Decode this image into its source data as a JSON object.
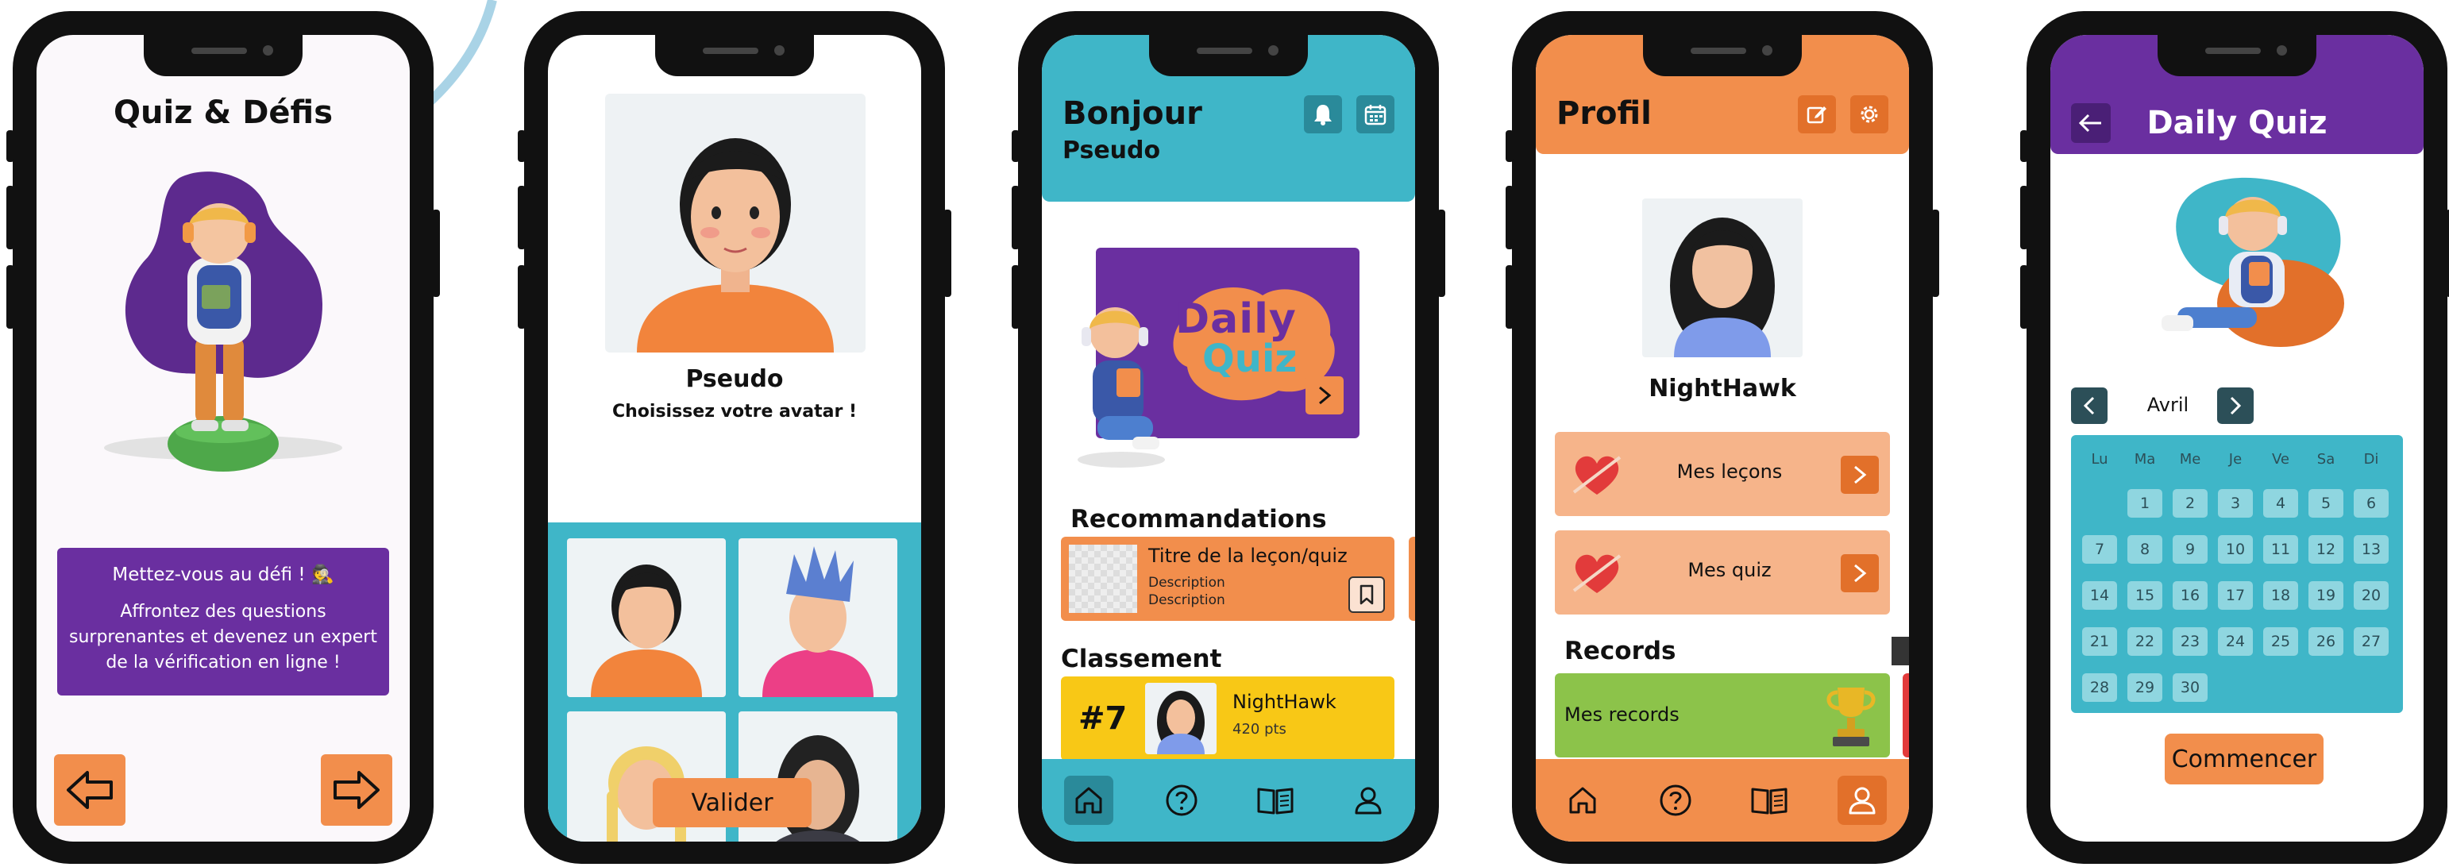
{
  "screen1": {
    "title": "Quiz & Défis",
    "card_line1": "Mettez-vous au défi ! 🕵",
    "card_line2": "Affrontez des questions surprenantes et devenez un expert de la vérification en ligne !"
  },
  "screen2": {
    "username": "Pseudo",
    "subtitle": "Choisissez votre avatar !",
    "validate_label": "Valider"
  },
  "screen3": {
    "greeting": "Bonjour",
    "username": "Pseudo",
    "banner_line1": "Daily",
    "banner_line2": "Quiz",
    "recommendations_title": "Recommandations",
    "rec_title": "Titre de la leçon/quiz",
    "rec_desc1": "Description",
    "rec_desc2": "Description",
    "ranking_title": "Classement",
    "rank": "#7",
    "rank_name": "NightHawk",
    "rank_points": "420 pts"
  },
  "screen4": {
    "title": "Profil",
    "username": "NightHawk",
    "lessons_label": "Mes leçons",
    "quiz_label": "Mes quiz",
    "records_title": "Records",
    "records_label": "Mes records"
  },
  "screen5": {
    "title": "Daily Quiz",
    "month": "Avril",
    "weekdays": [
      "Lu",
      "Ma",
      "Me",
      "Je",
      "Ve",
      "Sa",
      "Di"
    ],
    "days": [
      "1",
      "2",
      "3",
      "4",
      "5",
      "6",
      "7",
      "8",
      "9",
      "10",
      "11",
      "12",
      "13",
      "14",
      "15",
      "16",
      "17",
      "18",
      "19",
      "20",
      "21",
      "22",
      "23",
      "24",
      "25",
      "26",
      "27",
      "28",
      "29",
      "30"
    ],
    "start_label": "Commencer"
  },
  "colors": {
    "orange": "#f28e4c",
    "teal": "#3fb6c8",
    "purple": "#6a2fa0",
    "green": "#8cc34a",
    "yellow": "#f8c816",
    "light_orange": "#f6b48a"
  },
  "icons": [
    "bell-icon",
    "calendar-icon",
    "home-icon",
    "help-icon",
    "book-icon",
    "user-icon",
    "edit-icon",
    "settings-icon",
    "arrow-left-icon",
    "arrow-right-icon",
    "chevron-right-icon",
    "chevron-left-icon",
    "bookmark-icon",
    "heart-icon",
    "trophy-icon"
  ]
}
